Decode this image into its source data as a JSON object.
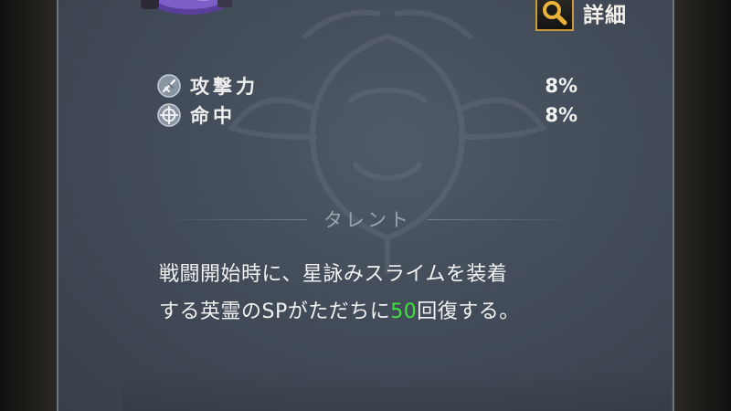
{
  "header": {
    "detail_label": "詳細",
    "detail_icon": "magnifier-icon",
    "item_thumbnail": "slime-item-thumbnail"
  },
  "stats": [
    {
      "icon": "attack-icon",
      "label": "攻撃力",
      "value": "8%"
    },
    {
      "icon": "accuracy-icon",
      "label": "命中",
      "value": "8%"
    }
  ],
  "talent": {
    "title": "タレント",
    "description_line1": "戦闘開始時に、星詠みスライムを装着",
    "description_line2_before": "する英霊のSPがただちに",
    "description_highlight": "50",
    "description_line2_after": "回復する。"
  },
  "colors": {
    "panel_bg": "#434c59",
    "highlight_number": "#3ee03e",
    "detail_border": "#c99a3c",
    "section_title": "#9aa3ad"
  }
}
